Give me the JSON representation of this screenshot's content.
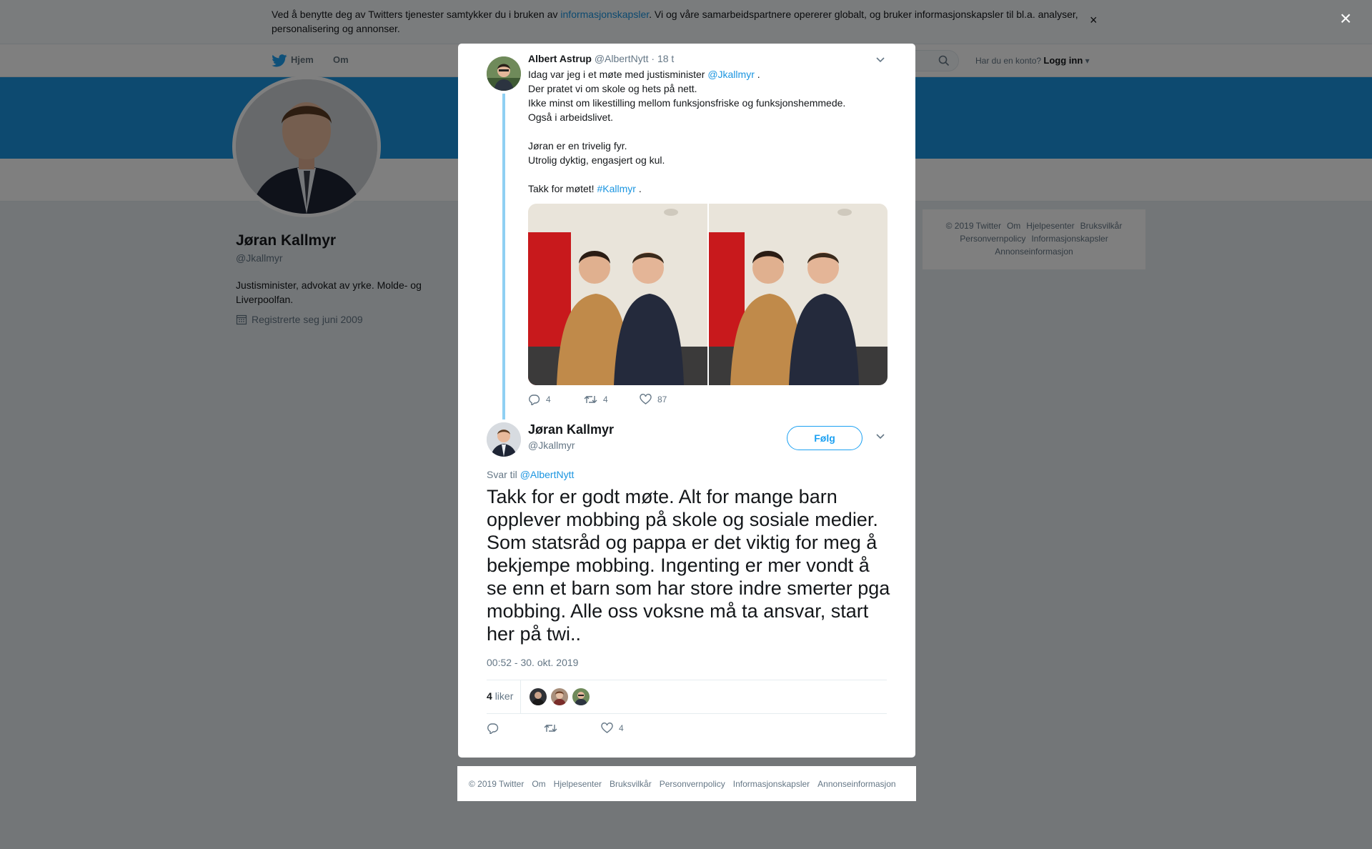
{
  "cookie_bar": {
    "text_before": "Ved å benytte deg av Twitters tjenester samtykker du i bruken av ",
    "link": "informasjonskapsler",
    "text_after": ". Vi og våre samarbeidspartnere opererer globalt, og bruker informasjonskapsler til bl.a. analyser, personalisering og annonser.",
    "close": "×"
  },
  "nav": {
    "home": "Hjem",
    "about": "Om",
    "account_prompt": "Har du en konto?",
    "login": "Logg inn"
  },
  "profile": {
    "name": "Jøran Kallmyr",
    "handle": "@Jkallmyr",
    "bio": "Justisminister, advokat av yrke. Molde- og Liverpoolfan.",
    "joined": "Registrerte seg juni 2009"
  },
  "side_footer": {
    "items_row1": [
      "© 2019 Twitter",
      "Om",
      "Hjelpesenter",
      "Bruksvilkår"
    ],
    "items_row2": [
      "Personvernpolicy",
      "Informasjonskapsler"
    ],
    "items_row3": [
      "Annonseinformasjon"
    ]
  },
  "overlay_close": "×",
  "parent_tweet": {
    "name": "Albert Astrup",
    "handle": "@AlbertNytt",
    "time": "· 18 t",
    "lines": [
      {
        "text": "Idag var jeg i et møte med justisminister ",
        "link": "@Jkallmyr",
        "after": " ."
      },
      {
        "text": "Der pratet vi om skole og hets på nett."
      },
      {
        "text": "Ikke minst om likestilling mellom funksjonsfriske og funksjonshemmede."
      },
      {
        "text": "Også i arbeidslivet."
      },
      {
        "text": ""
      },
      {
        "text": "Jøran er en trivelig fyr."
      },
      {
        "text": "Utrolig dyktig, engasjert og kul."
      },
      {
        "text": ""
      },
      {
        "text": "Takk for møtet! ",
        "link": "#Kallmyr",
        "after": " ."
      }
    ],
    "replies": "4",
    "retweets": "4",
    "likes": "87"
  },
  "main_tweet": {
    "name": "Jøran Kallmyr",
    "handle": "@Jkallmyr",
    "follow_label": "Følg",
    "reply_prefix": "Svar til ",
    "reply_to": "@AlbertNytt",
    "text": "Takk for er godt møte. Alt for mange barn opplever mobbing på skole og sosiale medier. Som statsråd og pappa er det viktig for meg å bekjempe mobbing. Ingenting er mer vondt å se enn et barn som har store indre smerter pga mobbing. Alle oss voksne må ta ansvar, start her på twi..",
    "timestamp": "00:52 - 30. okt. 2019",
    "like_count": "4",
    "like_label": "liker",
    "action_likes": "4"
  },
  "modal_footer": {
    "items": [
      "© 2019 Twitter",
      "Om",
      "Hjelpesenter",
      "Bruksvilkår",
      "Personvernpolicy",
      "Informasjonskapsler",
      "Annonseinformasjon"
    ]
  },
  "colors": {
    "accent": "#1da1f2",
    "banner": "#1b95e0",
    "thread_line": "#8fd0f3",
    "muted": "#657786"
  }
}
